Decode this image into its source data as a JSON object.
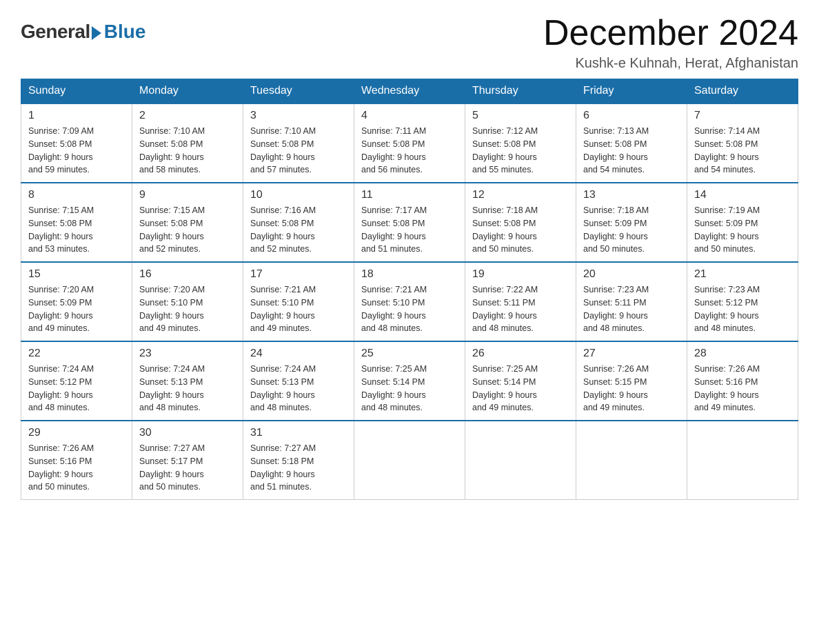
{
  "logo": {
    "general": "General",
    "blue": "Blue"
  },
  "title": "December 2024",
  "location": "Kushk-e Kuhnah, Herat, Afghanistan",
  "weekdays": [
    "Sunday",
    "Monday",
    "Tuesday",
    "Wednesday",
    "Thursday",
    "Friday",
    "Saturday"
  ],
  "weeks": [
    [
      {
        "day": "1",
        "sunrise": "7:09 AM",
        "sunset": "5:08 PM",
        "daylight": "9 hours and 59 minutes."
      },
      {
        "day": "2",
        "sunrise": "7:10 AM",
        "sunset": "5:08 PM",
        "daylight": "9 hours and 58 minutes."
      },
      {
        "day": "3",
        "sunrise": "7:10 AM",
        "sunset": "5:08 PM",
        "daylight": "9 hours and 57 minutes."
      },
      {
        "day": "4",
        "sunrise": "7:11 AM",
        "sunset": "5:08 PM",
        "daylight": "9 hours and 56 minutes."
      },
      {
        "day": "5",
        "sunrise": "7:12 AM",
        "sunset": "5:08 PM",
        "daylight": "9 hours and 55 minutes."
      },
      {
        "day": "6",
        "sunrise": "7:13 AM",
        "sunset": "5:08 PM",
        "daylight": "9 hours and 54 minutes."
      },
      {
        "day": "7",
        "sunrise": "7:14 AM",
        "sunset": "5:08 PM",
        "daylight": "9 hours and 54 minutes."
      }
    ],
    [
      {
        "day": "8",
        "sunrise": "7:15 AM",
        "sunset": "5:08 PM",
        "daylight": "9 hours and 53 minutes."
      },
      {
        "day": "9",
        "sunrise": "7:15 AM",
        "sunset": "5:08 PM",
        "daylight": "9 hours and 52 minutes."
      },
      {
        "day": "10",
        "sunrise": "7:16 AM",
        "sunset": "5:08 PM",
        "daylight": "9 hours and 52 minutes."
      },
      {
        "day": "11",
        "sunrise": "7:17 AM",
        "sunset": "5:08 PM",
        "daylight": "9 hours and 51 minutes."
      },
      {
        "day": "12",
        "sunrise": "7:18 AM",
        "sunset": "5:08 PM",
        "daylight": "9 hours and 50 minutes."
      },
      {
        "day": "13",
        "sunrise": "7:18 AM",
        "sunset": "5:09 PM",
        "daylight": "9 hours and 50 minutes."
      },
      {
        "day": "14",
        "sunrise": "7:19 AM",
        "sunset": "5:09 PM",
        "daylight": "9 hours and 50 minutes."
      }
    ],
    [
      {
        "day": "15",
        "sunrise": "7:20 AM",
        "sunset": "5:09 PM",
        "daylight": "9 hours and 49 minutes."
      },
      {
        "day": "16",
        "sunrise": "7:20 AM",
        "sunset": "5:10 PM",
        "daylight": "9 hours and 49 minutes."
      },
      {
        "day": "17",
        "sunrise": "7:21 AM",
        "sunset": "5:10 PM",
        "daylight": "9 hours and 49 minutes."
      },
      {
        "day": "18",
        "sunrise": "7:21 AM",
        "sunset": "5:10 PM",
        "daylight": "9 hours and 48 minutes."
      },
      {
        "day": "19",
        "sunrise": "7:22 AM",
        "sunset": "5:11 PM",
        "daylight": "9 hours and 48 minutes."
      },
      {
        "day": "20",
        "sunrise": "7:23 AM",
        "sunset": "5:11 PM",
        "daylight": "9 hours and 48 minutes."
      },
      {
        "day": "21",
        "sunrise": "7:23 AM",
        "sunset": "5:12 PM",
        "daylight": "9 hours and 48 minutes."
      }
    ],
    [
      {
        "day": "22",
        "sunrise": "7:24 AM",
        "sunset": "5:12 PM",
        "daylight": "9 hours and 48 minutes."
      },
      {
        "day": "23",
        "sunrise": "7:24 AM",
        "sunset": "5:13 PM",
        "daylight": "9 hours and 48 minutes."
      },
      {
        "day": "24",
        "sunrise": "7:24 AM",
        "sunset": "5:13 PM",
        "daylight": "9 hours and 48 minutes."
      },
      {
        "day": "25",
        "sunrise": "7:25 AM",
        "sunset": "5:14 PM",
        "daylight": "9 hours and 48 minutes."
      },
      {
        "day": "26",
        "sunrise": "7:25 AM",
        "sunset": "5:14 PM",
        "daylight": "9 hours and 49 minutes."
      },
      {
        "day": "27",
        "sunrise": "7:26 AM",
        "sunset": "5:15 PM",
        "daylight": "9 hours and 49 minutes."
      },
      {
        "day": "28",
        "sunrise": "7:26 AM",
        "sunset": "5:16 PM",
        "daylight": "9 hours and 49 minutes."
      }
    ],
    [
      {
        "day": "29",
        "sunrise": "7:26 AM",
        "sunset": "5:16 PM",
        "daylight": "9 hours and 50 minutes."
      },
      {
        "day": "30",
        "sunrise": "7:27 AM",
        "sunset": "5:17 PM",
        "daylight": "9 hours and 50 minutes."
      },
      {
        "day": "31",
        "sunrise": "7:27 AM",
        "sunset": "5:18 PM",
        "daylight": "9 hours and 51 minutes."
      },
      null,
      null,
      null,
      null
    ]
  ],
  "labels": {
    "sunrise": "Sunrise:",
    "sunset": "Sunset:",
    "daylight": "Daylight:"
  }
}
